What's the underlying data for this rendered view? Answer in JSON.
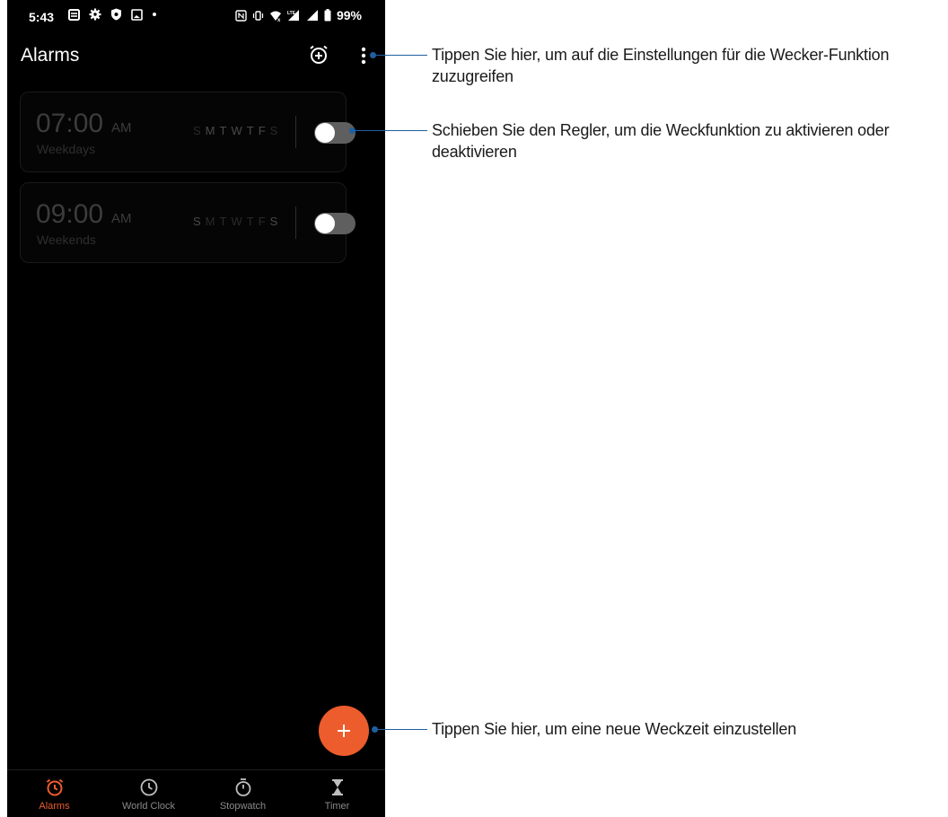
{
  "status_bar": {
    "time": "5:43",
    "left_icons": [
      "notification-icon",
      "settings-icon",
      "shield-icon",
      "image-icon",
      "dot-icon"
    ],
    "right_icons": [
      "nfc-icon",
      "vibrate-icon",
      "wifi-icon",
      "signal-lte-icon",
      "signal-bars-icon",
      "battery-icon"
    ],
    "battery": "99%"
  },
  "header": {
    "title": "Alarms",
    "add_alarm_icon": "alarm-add-icon",
    "menu_icon": "more-vert-icon"
  },
  "alarms": [
    {
      "time": "07:00",
      "ampm": "AM",
      "repeat": "Weekdays",
      "days": [
        "S",
        "M",
        "T",
        "W",
        "T",
        "F",
        "S"
      ],
      "active_days": [
        false,
        true,
        true,
        true,
        true,
        true,
        false
      ],
      "enabled": false
    },
    {
      "time": "09:00",
      "ampm": "AM",
      "repeat": "Weekends",
      "days": [
        "S",
        "M",
        "T",
        "W",
        "T",
        "F",
        "S"
      ],
      "active_days": [
        true,
        false,
        false,
        false,
        false,
        false,
        true
      ],
      "enabled": false
    }
  ],
  "fab": {
    "label": "+"
  },
  "bottom_nav": [
    {
      "label": "Alarms",
      "icon": "alarm-icon",
      "active": true
    },
    {
      "label": "World Clock",
      "icon": "clock-icon",
      "active": false
    },
    {
      "label": "Stopwatch",
      "icon": "stopwatch-icon",
      "active": false
    },
    {
      "label": "Timer",
      "icon": "hourglass-icon",
      "active": false
    }
  ],
  "callouts": [
    {
      "text": "Tippen Sie hier, um auf die Einstellungen für die Wecker-Funktion zuzugreifen"
    },
    {
      "text": "Schieben Sie den Regler, um die Weckfunktion zu aktivieren oder deaktivieren"
    },
    {
      "text": "Tippen Sie hier, um eine neue Weckzeit einzustellen"
    }
  ],
  "colors": {
    "accent": "#ec5c2c",
    "callout": "#1f5fa0",
    "background": "#000000"
  }
}
